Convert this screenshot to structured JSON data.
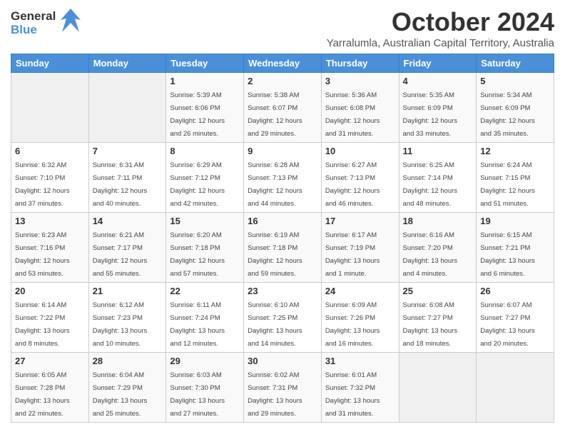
{
  "logo": {
    "general": "General",
    "blue": "Blue"
  },
  "title": "October 2024",
  "subtitle": "Yarralumla, Australian Capital Territory, Australia",
  "days_of_week": [
    "Sunday",
    "Monday",
    "Tuesday",
    "Wednesday",
    "Thursday",
    "Friday",
    "Saturday"
  ],
  "weeks": [
    [
      {
        "day": "",
        "info": ""
      },
      {
        "day": "",
        "info": ""
      },
      {
        "day": "1",
        "info": "Sunrise: 5:39 AM\nSunset: 6:06 PM\nDaylight: 12 hours\nand 26 minutes."
      },
      {
        "day": "2",
        "info": "Sunrise: 5:38 AM\nSunset: 6:07 PM\nDaylight: 12 hours\nand 29 minutes."
      },
      {
        "day": "3",
        "info": "Sunrise: 5:36 AM\nSunset: 6:08 PM\nDaylight: 12 hours\nand 31 minutes."
      },
      {
        "day": "4",
        "info": "Sunrise: 5:35 AM\nSunset: 6:09 PM\nDaylight: 12 hours\nand 33 minutes."
      },
      {
        "day": "5",
        "info": "Sunrise: 5:34 AM\nSunset: 6:09 PM\nDaylight: 12 hours\nand 35 minutes."
      }
    ],
    [
      {
        "day": "6",
        "info": "Sunrise: 6:32 AM\nSunset: 7:10 PM\nDaylight: 12 hours\nand 37 minutes."
      },
      {
        "day": "7",
        "info": "Sunrise: 6:31 AM\nSunset: 7:11 PM\nDaylight: 12 hours\nand 40 minutes."
      },
      {
        "day": "8",
        "info": "Sunrise: 6:29 AM\nSunset: 7:12 PM\nDaylight: 12 hours\nand 42 minutes."
      },
      {
        "day": "9",
        "info": "Sunrise: 6:28 AM\nSunset: 7:13 PM\nDaylight: 12 hours\nand 44 minutes."
      },
      {
        "day": "10",
        "info": "Sunrise: 6:27 AM\nSunset: 7:13 PM\nDaylight: 12 hours\nand 46 minutes."
      },
      {
        "day": "11",
        "info": "Sunrise: 6:25 AM\nSunset: 7:14 PM\nDaylight: 12 hours\nand 48 minutes."
      },
      {
        "day": "12",
        "info": "Sunrise: 6:24 AM\nSunset: 7:15 PM\nDaylight: 12 hours\nand 51 minutes."
      }
    ],
    [
      {
        "day": "13",
        "info": "Sunrise: 6:23 AM\nSunset: 7:16 PM\nDaylight: 12 hours\nand 53 minutes."
      },
      {
        "day": "14",
        "info": "Sunrise: 6:21 AM\nSunset: 7:17 PM\nDaylight: 12 hours\nand 55 minutes."
      },
      {
        "day": "15",
        "info": "Sunrise: 6:20 AM\nSunset: 7:18 PM\nDaylight: 12 hours\nand 57 minutes."
      },
      {
        "day": "16",
        "info": "Sunrise: 6:19 AM\nSunset: 7:18 PM\nDaylight: 12 hours\nand 59 minutes."
      },
      {
        "day": "17",
        "info": "Sunrise: 6:17 AM\nSunset: 7:19 PM\nDaylight: 13 hours\nand 1 minute."
      },
      {
        "day": "18",
        "info": "Sunrise: 6:16 AM\nSunset: 7:20 PM\nDaylight: 13 hours\nand 4 minutes."
      },
      {
        "day": "19",
        "info": "Sunrise: 6:15 AM\nSunset: 7:21 PM\nDaylight: 13 hours\nand 6 minutes."
      }
    ],
    [
      {
        "day": "20",
        "info": "Sunrise: 6:14 AM\nSunset: 7:22 PM\nDaylight: 13 hours\nand 8 minutes."
      },
      {
        "day": "21",
        "info": "Sunrise: 6:12 AM\nSunset: 7:23 PM\nDaylight: 13 hours\nand 10 minutes."
      },
      {
        "day": "22",
        "info": "Sunrise: 6:11 AM\nSunset: 7:24 PM\nDaylight: 13 hours\nand 12 minutes."
      },
      {
        "day": "23",
        "info": "Sunrise: 6:10 AM\nSunset: 7:25 PM\nDaylight: 13 hours\nand 14 minutes."
      },
      {
        "day": "24",
        "info": "Sunrise: 6:09 AM\nSunset: 7:26 PM\nDaylight: 13 hours\nand 16 minutes."
      },
      {
        "day": "25",
        "info": "Sunrise: 6:08 AM\nSunset: 7:27 PM\nDaylight: 13 hours\nand 18 minutes."
      },
      {
        "day": "26",
        "info": "Sunrise: 6:07 AM\nSunset: 7:27 PM\nDaylight: 13 hours\nand 20 minutes."
      }
    ],
    [
      {
        "day": "27",
        "info": "Sunrise: 6:05 AM\nSunset: 7:28 PM\nDaylight: 13 hours\nand 22 minutes."
      },
      {
        "day": "28",
        "info": "Sunrise: 6:04 AM\nSunset: 7:29 PM\nDaylight: 13 hours\nand 25 minutes."
      },
      {
        "day": "29",
        "info": "Sunrise: 6:03 AM\nSunset: 7:30 PM\nDaylight: 13 hours\nand 27 minutes."
      },
      {
        "day": "30",
        "info": "Sunrise: 6:02 AM\nSunset: 7:31 PM\nDaylight: 13 hours\nand 29 minutes."
      },
      {
        "day": "31",
        "info": "Sunrise: 6:01 AM\nSunset: 7:32 PM\nDaylight: 13 hours\nand 31 minutes."
      },
      {
        "day": "",
        "info": ""
      },
      {
        "day": "",
        "info": ""
      }
    ]
  ]
}
